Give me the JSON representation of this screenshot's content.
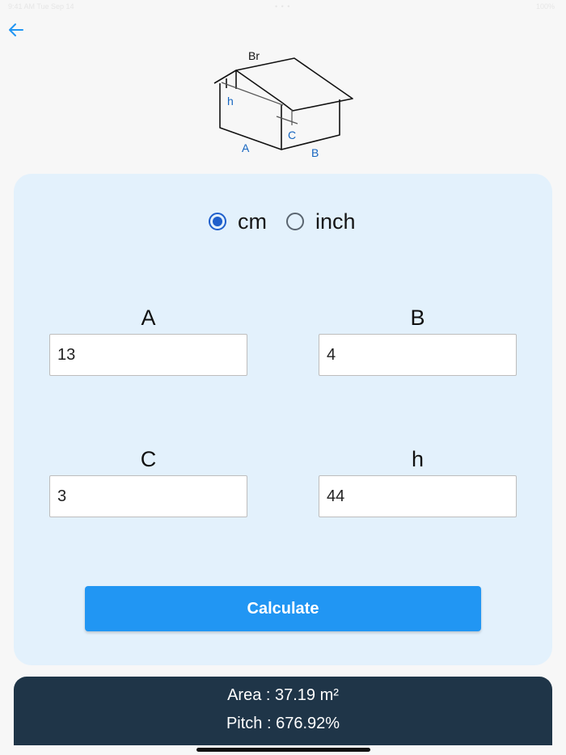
{
  "status_bar": {
    "left": "9:41 AM Tue Sep 14",
    "center": "• • •",
    "right": "100%"
  },
  "diagram": {
    "label_br": "Br",
    "label_h": "h",
    "label_c": "C",
    "label_a": "A",
    "label_b": "B"
  },
  "units": {
    "selected": "cm",
    "options": [
      {
        "label": "cm",
        "checked": true
      },
      {
        "label": "inch",
        "checked": false
      }
    ]
  },
  "fields": {
    "a": {
      "label": "A",
      "value": "13"
    },
    "b": {
      "label": "B",
      "value": "4"
    },
    "c": {
      "label": "C",
      "value": "3"
    },
    "h": {
      "label": "h",
      "value": "44"
    }
  },
  "calculate_label": "Calculate",
  "results": {
    "area": "Area : 37.19 m²",
    "pitch": "Pitch : 676.92%"
  },
  "colors": {
    "accent": "#2196f3",
    "radio_selected": "#1f5fcc",
    "card_background": "#e3f1fc",
    "results_background": "#1f3548",
    "diagram_label_blue": "#1565c0"
  },
  "icons": {
    "back": "arrow-left-icon",
    "diagram": "house-roof-icon"
  }
}
